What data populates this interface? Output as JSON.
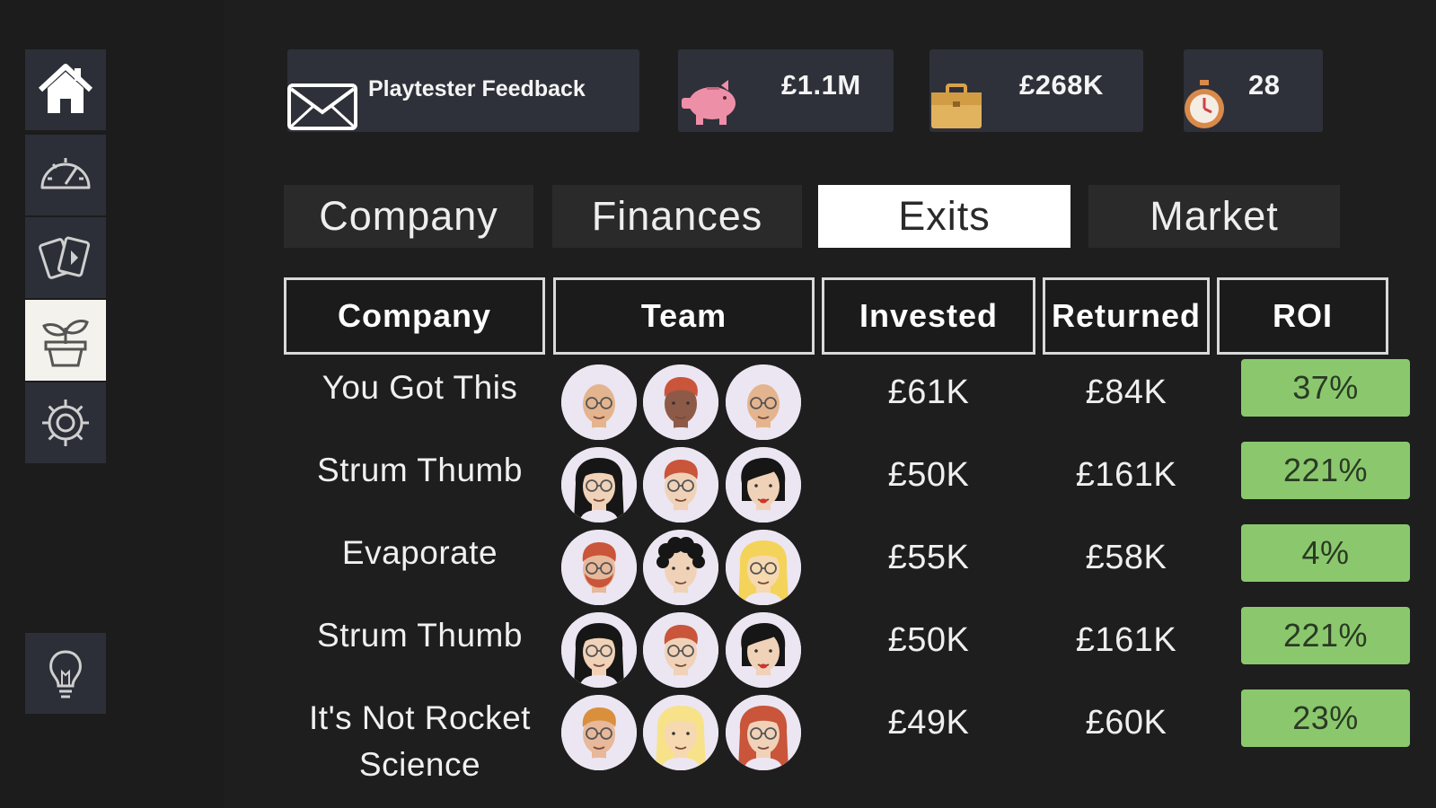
{
  "sidebar": {
    "items": [
      {
        "name": "home",
        "icon": "home-icon",
        "active": false
      },
      {
        "name": "dashboard",
        "icon": "speedometer-icon",
        "active": false
      },
      {
        "name": "cards",
        "icon": "cards-icon",
        "active": false
      },
      {
        "name": "investments",
        "icon": "plant-pot-icon",
        "active": true
      },
      {
        "name": "settings",
        "icon": "gear-icon",
        "active": false
      }
    ],
    "hint": {
      "name": "hint",
      "icon": "lightbulb-icon"
    }
  },
  "resources": {
    "feedback_label": "Playtester Feedback",
    "cash": "£1.1M",
    "portfolio": "£268K",
    "turns": "28"
  },
  "tabs": [
    {
      "label": "Company",
      "active": false
    },
    {
      "label": "Finances",
      "active": false
    },
    {
      "label": "Exits",
      "active": true
    },
    {
      "label": "Market",
      "active": false
    }
  ],
  "table": {
    "columns": [
      "Company",
      "Team",
      "Invested",
      "Returned",
      "ROI"
    ],
    "rows": [
      {
        "company": "You Got This",
        "invested": "£61K",
        "returned": "£84K",
        "roi": "37%",
        "team": [
          {
            "skin": "#e4b48e",
            "hair": "#e4b48e",
            "style": "bald",
            "glasses": true
          },
          {
            "skin": "#8d5a48",
            "hair": "#c9553a",
            "style": "short",
            "glasses": false
          },
          {
            "skin": "#e4b48e",
            "hair": "#e4b48e",
            "style": "bald",
            "glasses": true
          }
        ]
      },
      {
        "company": "Strum Thumb",
        "invested": "£50K",
        "returned": "£161K",
        "roi": "221%",
        "team": [
          {
            "skin": "#f0d2b8",
            "hair": "#161616",
            "style": "long",
            "glasses": true
          },
          {
            "skin": "#f0d2b8",
            "hair": "#c9553a",
            "style": "short",
            "glasses": true
          },
          {
            "skin": "#f0d2b8",
            "hair": "#161616",
            "style": "side",
            "glasses": false
          }
        ]
      },
      {
        "company": "Evaporate",
        "invested": "£55K",
        "returned": "£58K",
        "roi": "4%",
        "team": [
          {
            "skin": "#e7b89a",
            "hair": "#c9553a",
            "style": "beard",
            "glasses": true
          },
          {
            "skin": "#f0d2b8",
            "hair": "#161616",
            "style": "curly",
            "glasses": false
          },
          {
            "skin": "#f6d9b0",
            "hair": "#f4d35a",
            "style": "long",
            "glasses": true
          }
        ]
      },
      {
        "company": "Strum Thumb",
        "invested": "£50K",
        "returned": "£161K",
        "roi": "221%",
        "team": [
          {
            "skin": "#f0d2b8",
            "hair": "#161616",
            "style": "long",
            "glasses": true
          },
          {
            "skin": "#f0d2b8",
            "hair": "#c9553a",
            "style": "short",
            "glasses": true
          },
          {
            "skin": "#f0d2b8",
            "hair": "#161616",
            "style": "side",
            "glasses": false
          }
        ]
      },
      {
        "company": "It's Not Rocket Science",
        "invested": "£49K",
        "returned": "£60K",
        "roi": "23%",
        "team": [
          {
            "skin": "#e7b89a",
            "hair": "#d98f3c",
            "style": "short",
            "glasses": true
          },
          {
            "skin": "#f6d9b0",
            "hair": "#f7e28a",
            "style": "long",
            "glasses": false
          },
          {
            "skin": "#f0d2b8",
            "hair": "#c9553a",
            "style": "long",
            "glasses": true
          }
        ]
      }
    ]
  },
  "colors": {
    "background": "#1c1c1c",
    "panel": "#2e313a",
    "roi_positive": "#8bc86d",
    "tab_active": "#ffffff"
  }
}
